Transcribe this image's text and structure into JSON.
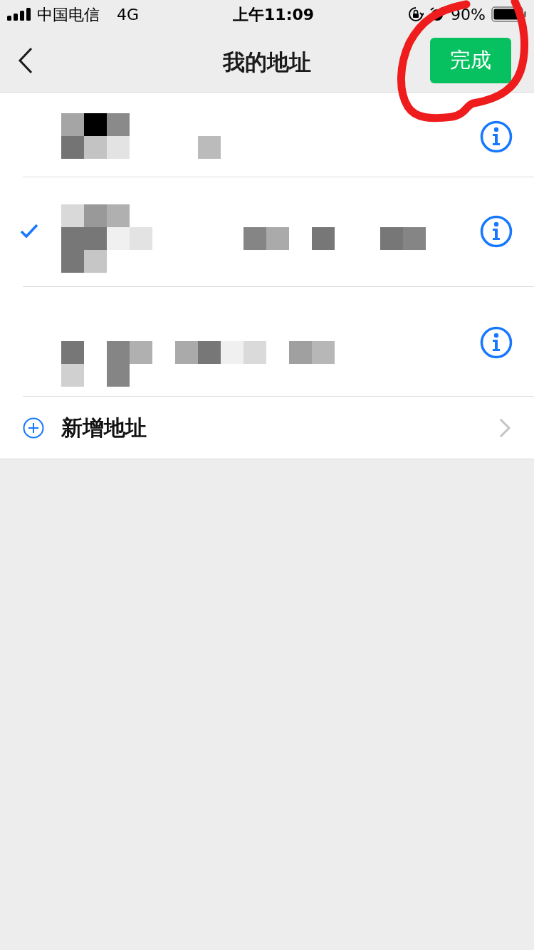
{
  "status_bar": {
    "carrier": "中国电信",
    "network": "4G",
    "time": "上午11:09",
    "battery": "90%"
  },
  "nav": {
    "title": "我的地址",
    "done_button": "完成"
  },
  "addresses": [
    {
      "selected": false
    },
    {
      "selected": true
    },
    {
      "selected": false
    }
  ],
  "add_row": {
    "label": "新增地址"
  }
}
